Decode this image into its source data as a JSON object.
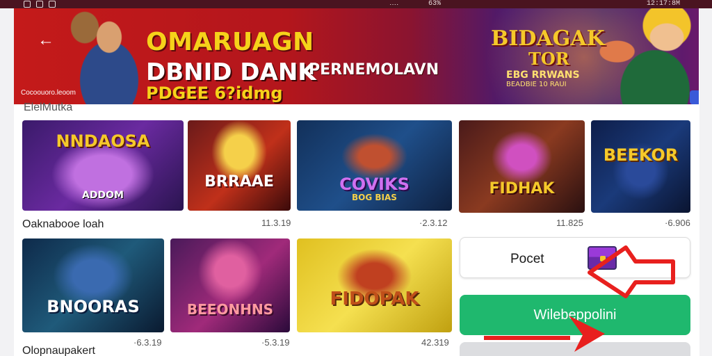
{
  "status_bar": {
    "signal": "‥‥",
    "battery": "63%",
    "time": "12:17:8M"
  },
  "banner": {
    "title_1": "OMARUAGN",
    "title_2": "DBNID DANK",
    "title_3": "PDGEE 6?idmg",
    "subtitle": "PERNEMOLAVN",
    "promo_title": "BIDAGAK",
    "promo_title_2": "TOR",
    "promo_sub": "EBG RRWANS",
    "promo_sub_2": "BEADBIE 10 RAUI",
    "caption": "Cocoouoro.leoom"
  },
  "section_title": "ElelMutka",
  "games": [
    {
      "title": "NNDAOSA",
      "subtitle": "ADDOM"
    },
    {
      "title": "BRRAAE",
      "subtitle": ""
    },
    {
      "title": "COVIKS",
      "subtitle": "BOG BIAS"
    },
    {
      "title": "FIDHAK",
      "subtitle": ""
    },
    {
      "title": "BEEKOR",
      "subtitle": ""
    },
    {
      "title": "BNOORAS",
      "subtitle": ""
    },
    {
      "title": "BEEONHNS",
      "subtitle": ""
    },
    {
      "title": "FIDOPAK",
      "subtitle": ""
    }
  ],
  "row1": {
    "label": "Oaknabooe loah",
    "metas": [
      "11.3.19",
      "·2.3.12",
      "11.825",
      "·6.906"
    ]
  },
  "row2": {
    "label": "Olopnaupakert",
    "metas": [
      "·6.3.19",
      "·5.3.19",
      "42.319"
    ]
  },
  "actions": {
    "post_label": "Pocet",
    "primary_label": "Wilebeppolini"
  },
  "colors": {
    "accent_green": "#1fb86e",
    "banner_red": "#c41a1a",
    "arrow_red": "#e8201e"
  }
}
